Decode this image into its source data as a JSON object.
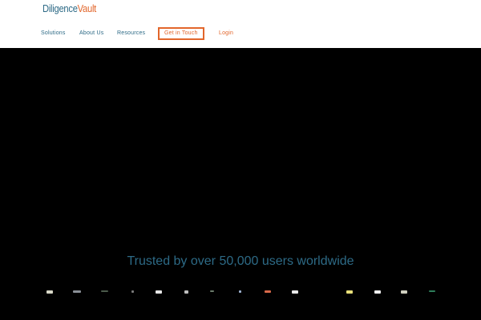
{
  "header": {
    "logo_part1": "Diligence",
    "logo_part2": "Vault"
  },
  "nav": {
    "solutions": "Solutions",
    "about": "About Us",
    "resources": "Resources",
    "get_in_touch": "Get in Touch",
    "login": "Login"
  },
  "hero": {
    "trusted_text": "Trusted by over 50,000 users worldwide"
  },
  "colors": {
    "brand_blue": "#2d6a86",
    "brand_orange": "#e2662b",
    "hero_bg": "#000000"
  },
  "client_logos": [
    {
      "name": "client-logo-1",
      "color": "#d8d8c8"
    },
    {
      "name": "client-logo-2",
      "color": "#8a8f96"
    },
    {
      "name": "client-logo-3",
      "color": "#4a5a4a"
    },
    {
      "name": "client-logo-4",
      "color": "#7b7b7b"
    },
    {
      "name": "client-logo-5",
      "color": "#e5e5e5"
    },
    {
      "name": "client-logo-6",
      "color": "#bdbdbd"
    },
    {
      "name": "client-logo-7",
      "color": "#6b7b6b"
    },
    {
      "name": "client-logo-8",
      "color": "#9fb3d1"
    },
    {
      "name": "client-logo-9",
      "color": "#d9694a"
    },
    {
      "name": "client-logo-10",
      "color": "#e8e8e8"
    },
    {
      "name": "client-logo-11",
      "color": "#e8e07a"
    },
    {
      "name": "client-logo-12",
      "color": "#f0f0f0"
    },
    {
      "name": "client-logo-13",
      "color": "#d0d0c0"
    },
    {
      "name": "client-logo-14",
      "color": "#2e7d5a"
    }
  ]
}
